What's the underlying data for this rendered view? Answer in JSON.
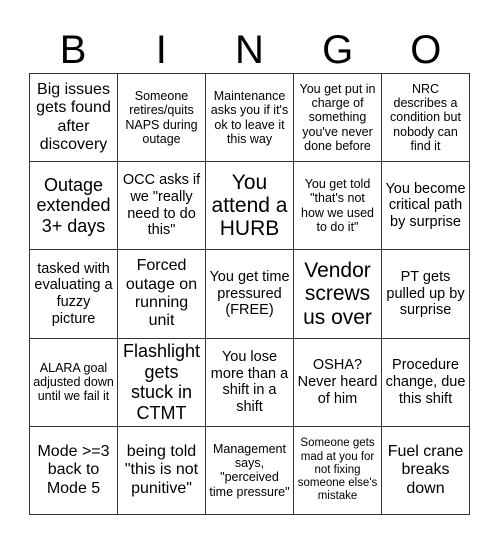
{
  "header": {
    "letters": [
      "B",
      "I",
      "N",
      "G",
      "O"
    ]
  },
  "cells": [
    [
      "Big issues gets found after discovery",
      "Someone retires/quits NAPS during outage",
      "Maintenance asks you if it's ok to leave it this way",
      "You get put in charge of something you've never done before",
      "NRC describes a condition but nobody can find it"
    ],
    [
      "Outage extended 3+ days",
      "OCC asks if we \"really need to do this\"",
      "You attend a HURB",
      "You get told \"that's not how we used to do it\"",
      "You become critical path by surprise"
    ],
    [
      "tasked with evaluating a fuzzy picture",
      "Forced outage on running unit",
      "You get time pressured (FREE)",
      "Vendor screws us over",
      "PT gets pulled up by surprise"
    ],
    [
      "ALARA goal adjusted down until we fail it",
      "Flashlight gets stuck in CTMT",
      "You lose more than a shift in a shift",
      "OSHA? Never heard of him",
      "Procedure change, due this shift"
    ],
    [
      "Mode >=3 back to Mode 5",
      "being told \"this is not punitive\"",
      "Management says, \"perceived time pressure\"",
      "Someone gets mad at you for not fixing someone else's mistake",
      "Fuel crane breaks down"
    ]
  ]
}
